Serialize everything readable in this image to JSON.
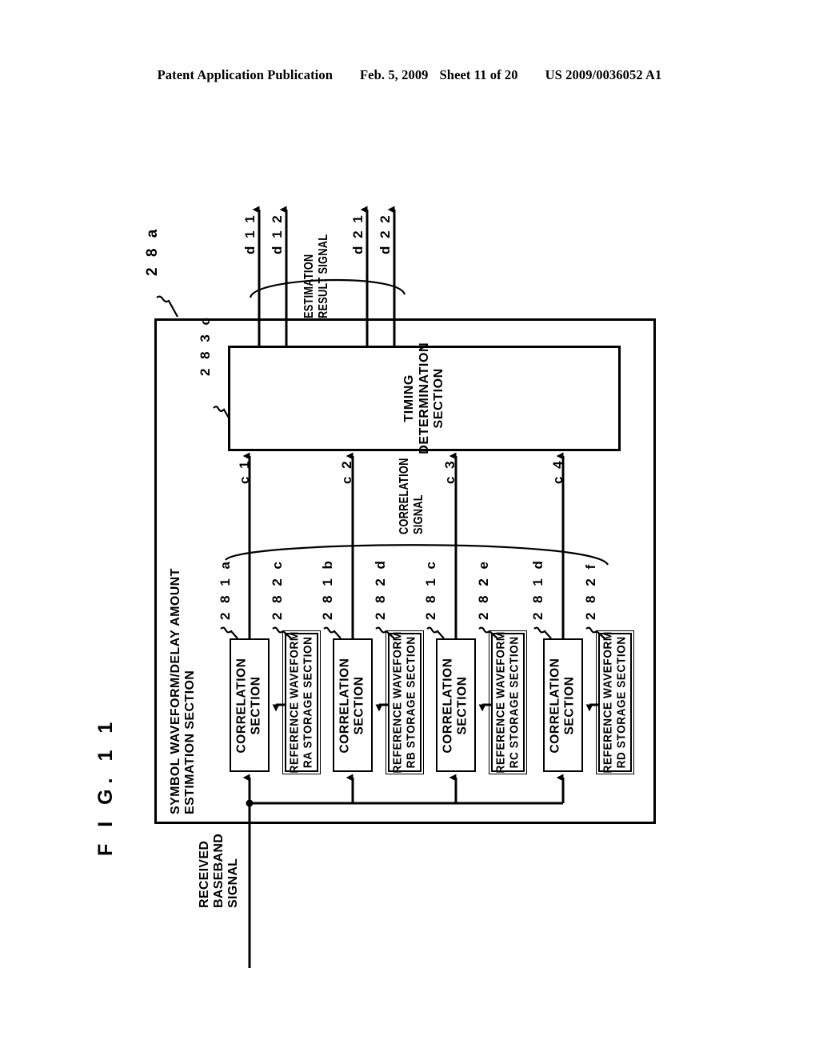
{
  "header": {
    "publication": "Patent Application Publication",
    "date": "Feb. 5, 2009",
    "sheet": "Sheet 11 of 20",
    "patent_number": "US 2009/0036052 A1"
  },
  "figure": {
    "label": "F I G.  1 1"
  },
  "diagram": {
    "outer_ref": "2 8 a",
    "outer_title_line1": "SYMBOL WAVEFORM/DELAY AMOUNT",
    "outer_title_line2": "ESTIMATION SECTION",
    "input_label_line1": "RECEIVED",
    "input_label_line2": "BASEBAND",
    "input_label_line3": "SIGNAL",
    "timing": {
      "ref": "2 8 3 c",
      "title_line1": "TIMING",
      "title_line2": "DETERMINATION",
      "title_line3": "SECTION"
    },
    "estimation_result_label_line1": "ESTIMATION",
    "estimation_result_label_line2": "RESULT SIGNAL",
    "correlation_signal_label_line1": "CORRELATION",
    "correlation_signal_label_line2": "SIGNAL",
    "outputs": [
      {
        "name": "d 1 1"
      },
      {
        "name": "d 1 2"
      },
      {
        "name": "d 2 1"
      },
      {
        "name": "d 2 2"
      }
    ],
    "correlation_signals": [
      {
        "name": "c 1"
      },
      {
        "name": "c 2"
      },
      {
        "name": "c 3"
      },
      {
        "name": "c 4"
      }
    ],
    "correlation_sections": [
      {
        "ref": "2 8 1 a",
        "title_line1": "CORRELATION",
        "title_line2": "SECTION"
      },
      {
        "ref": "2 8 1 b",
        "title_line1": "CORRELATION",
        "title_line2": "SECTION"
      },
      {
        "ref": "2 8 1 c",
        "title_line1": "CORRELATION",
        "title_line2": "SECTION"
      },
      {
        "ref": "2 8 1 d",
        "title_line1": "CORRELATION",
        "title_line2": "SECTION"
      }
    ],
    "reference_waveform_sections": [
      {
        "ref": "2 8 2 c",
        "title_line1": "REFERENCE WAVEFORM",
        "title_line2": "RA STORAGE SECTION"
      },
      {
        "ref": "2 8 2 d",
        "title_line1": "REFERENCE WAVEFORM",
        "title_line2": "RB STORAGE SECTION"
      },
      {
        "ref": "2 8 2 e",
        "title_line1": "REFERENCE WAVEFORM",
        "title_line2": "RC STORAGE SECTION"
      },
      {
        "ref": "2 8 2 f",
        "title_line1": "REFERENCE WAVEFORM",
        "title_line2": "RD STORAGE SECTION"
      }
    ]
  }
}
